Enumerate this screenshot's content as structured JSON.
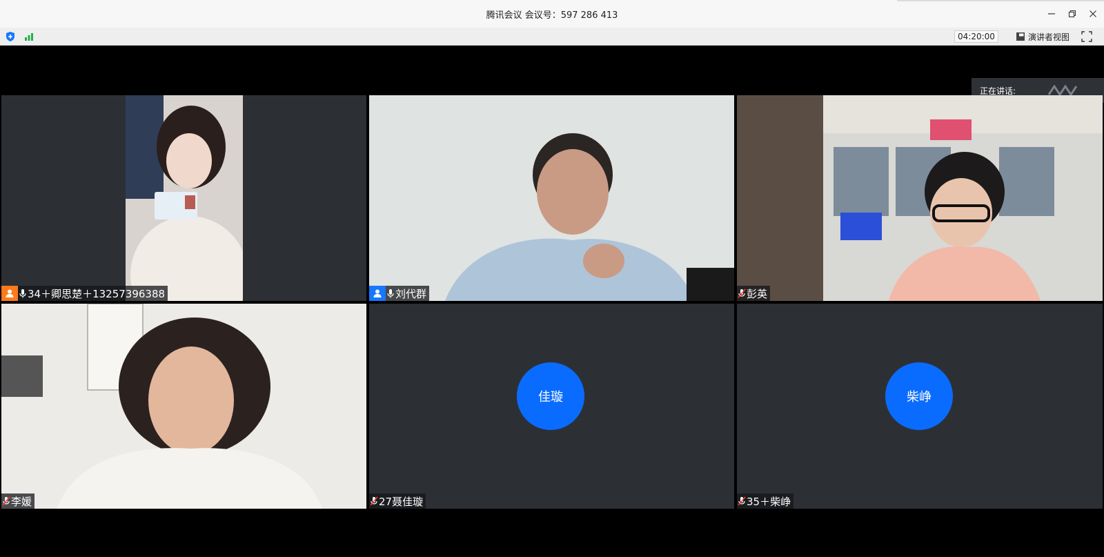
{
  "window": {
    "title": "腾讯会议 会议号：597 286 413"
  },
  "toolbar": {
    "timer": "04:20:00",
    "presenter_view_label": "演讲者视图",
    "icons": [
      "shield-icon",
      "signal-icon",
      "presenter-view-icon",
      "fullscreen-icon"
    ]
  },
  "speaking_now": {
    "label": "正在讲话:"
  },
  "participants": [
    {
      "label": "34＋卿思楚＋13257396388",
      "host": true,
      "host_color": "#ff7a1a",
      "muted": false,
      "video": true
    },
    {
      "label": "刘代群",
      "host": true,
      "host_color": "#1677ff",
      "muted": false,
      "video": true
    },
    {
      "label": "彭英",
      "host": false,
      "muted": true,
      "video": true
    },
    {
      "label": "李媛",
      "host": false,
      "muted": true,
      "video": true
    },
    {
      "label": "27聂佳璇",
      "host": false,
      "muted": true,
      "video": false,
      "avatar_text": "佳璇"
    },
    {
      "label": "35＋柴峥",
      "host": false,
      "muted": true,
      "video": false,
      "avatar_text": "柴峥"
    }
  ],
  "colors": {
    "avatar_blue": "#0a6cff",
    "tile_bg": "#2c3035",
    "stage_bg": "#000000"
  }
}
